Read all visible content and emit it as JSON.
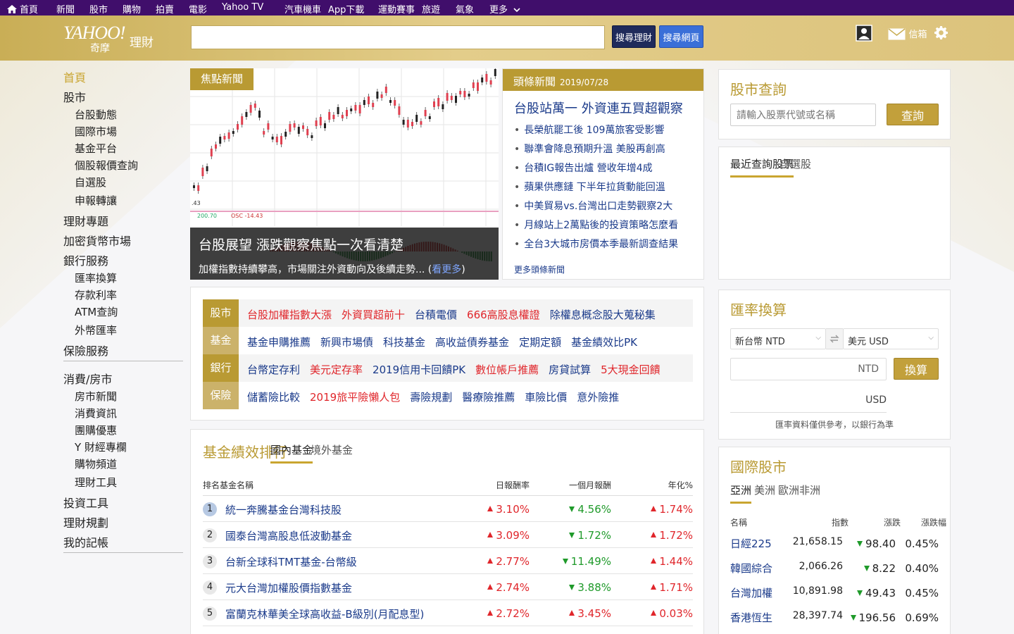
{
  "topnav": {
    "items": [
      "首頁",
      "新聞",
      "股市",
      "購物",
      "拍賣",
      "電影",
      "Yahoo TV",
      "汽車機車",
      "App下載",
      "運動賽事",
      "旅遊",
      "氣象",
      "更多"
    ]
  },
  "header": {
    "logo_text": "YAHOO!",
    "logo_sub": "理財",
    "logo_sub2": "奇摩",
    "search_value": "",
    "search_placeholder": "",
    "search_finance_label": "搜尋理財",
    "search_web_label": "搜尋網頁",
    "mail_label": "信箱"
  },
  "sidebar": {
    "items": [
      {
        "label": "首頁",
        "level": 0,
        "active": true
      },
      {
        "label": "股市",
        "level": 0
      },
      {
        "label": "台股動態",
        "level": 1
      },
      {
        "label": "國際市場",
        "level": 1
      },
      {
        "label": "基金平台",
        "level": 1
      },
      {
        "label": "個股報價查詢",
        "level": 1
      },
      {
        "label": "自選股",
        "level": 1
      },
      {
        "label": "申報轉讓",
        "level": 1
      },
      {
        "label": "理財專題",
        "level": 0
      },
      {
        "label": "加密貨幣市場",
        "level": 0
      },
      {
        "label": "銀行服務",
        "level": 0
      },
      {
        "label": "匯率換算",
        "level": 1
      },
      {
        "label": "存款利率",
        "level": 1
      },
      {
        "label": "ATM查詢",
        "level": 1
      },
      {
        "label": "外幣匯率",
        "level": 1
      },
      {
        "label": "保險服務",
        "level": 0
      },
      {
        "label": "消費/房市",
        "level": 0
      },
      {
        "label": "房市新聞",
        "level": 1
      },
      {
        "label": "消費資訊",
        "level": 1
      },
      {
        "label": "團購優惠",
        "level": 1
      },
      {
        "label": "Y 財經專欄",
        "level": 1
      },
      {
        "label": "購物頻道",
        "level": 1
      },
      {
        "label": "理財工具",
        "level": 1
      },
      {
        "label": "投資工具",
        "level": 0
      },
      {
        "label": "理財規劃",
        "level": 0
      },
      {
        "label": "我的記帳",
        "level": 0
      }
    ]
  },
  "feature": {
    "tag": "焦點新聞",
    "title": "台股展望 漲跌觀察焦點一次看清楚",
    "subtitle": "加權指數持續攀高，市場關注外資動向及後續走勢",
    "more_label": "看更多",
    "chart_labels": {
      "left_axis": ".43",
      "mid": "200.70",
      "osc": "OSC -14.43"
    }
  },
  "topnews": {
    "tag": "頭條新聞",
    "date": "2019/07/28",
    "headline": "台股站萬一 外資連五買超觀察",
    "items": [
      "長榮航罷工後 109萬旅客受影響",
      "聯準會降息預期升溫 美股再創高",
      "台積IG報告出爐 營收年增4成",
      "蘋果供應鏈 下半年拉貨動能回溫",
      "中美貿易vs.台灣出口走勢觀察2大",
      "月線站上2萬點後的投資策略怎麼看",
      "全台3大城市房價本季最新調查結果"
    ],
    "more_label": "更多頭條新聞"
  },
  "tags": {
    "rows": [
      {
        "label": "股市",
        "links": [
          {
            "t": "台股加權指數大漲",
            "red": true
          },
          {
            "t": "外資買超前十",
            "red": true
          },
          {
            "t": "台積電價",
            "red": false
          },
          {
            "t": "666高股息權證",
            "red": true
          },
          {
            "t": "除權息概念股大蒐秘集",
            "red": false
          }
        ]
      },
      {
        "label": "基金",
        "links": [
          {
            "t": "基金申購推薦",
            "red": false
          },
          {
            "t": "新興市場債",
            "red": false
          },
          {
            "t": "科技基金",
            "red": false
          },
          {
            "t": "高收益債券基金",
            "red": false
          },
          {
            "t": "定期定額",
            "red": false
          },
          {
            "t": "基金績效比PK",
            "red": false
          }
        ]
      },
      {
        "label": "銀行",
        "links": [
          {
            "t": "台幣定存利",
            "red": false
          },
          {
            "t": "美元定存率",
            "red": true
          },
          {
            "t": "2019信用卡回饋PK",
            "red": false
          },
          {
            "t": "數位帳戶推薦",
            "red": true
          },
          {
            "t": "房貸試算",
            "red": false
          },
          {
            "t": "5大現金回饋",
            "red": true
          }
        ]
      },
      {
        "label": "保險",
        "links": [
          {
            "t": "儲蓄險比較",
            "red": false
          },
          {
            "t": "2019旅平險懶人包",
            "red": true
          },
          {
            "t": "壽險規劃",
            "red": false
          },
          {
            "t": "醫療險推薦",
            "red": false
          },
          {
            "t": "車險比價",
            "red": false
          },
          {
            "t": "意外險推",
            "red": false
          }
        ]
      }
    ]
  },
  "funds": {
    "title": "基金績效排行",
    "tabs": [
      "國內基金",
      "境外基金"
    ],
    "headers": {
      "rank": "排名",
      "name": "基金名稱",
      "d1": "日報酬率",
      "m1": "一個月報酬",
      "y": "年化%"
    },
    "rows": [
      {
        "rank": "1",
        "name": "統一奔騰基金台灣科技股",
        "d1": "3.10%",
        "d1_up": true,
        "m1": "4.56%",
        "m1_up": false,
        "y": "1.74%",
        "y_up": true
      },
      {
        "rank": "2",
        "name": "國泰台灣高股息低波動基金",
        "d1": "3.09%",
        "d1_up": true,
        "m1": "1.72%",
        "m1_up": false,
        "y": "1.72%",
        "y_up": true
      },
      {
        "rank": "3",
        "name": "台新全球科TMT基金-台幣級",
        "d1": "2.77%",
        "d1_up": true,
        "m1": "11.49%",
        "m1_up": false,
        "y": "1.44%",
        "y_up": true
      },
      {
        "rank": "4",
        "name": "元大台灣加權股價指數基金",
        "d1": "2.74%",
        "d1_up": true,
        "m1": "3.88%",
        "m1_up": false,
        "y": "1.71%",
        "y_up": true
      },
      {
        "rank": "5",
        "name": "富蘭克林華美全球高收益-B級別(月配息型)",
        "d1": "2.72%",
        "d1_up": true,
        "m1": "3.45%",
        "m1_up": true,
        "y": "0.03%",
        "y_up": true
      }
    ]
  },
  "quote": {
    "title": "股市查詢",
    "input_placeholder": "請輸入股票代號或名稱",
    "button": "查詢",
    "tabs": [
      "最近查詢股票",
      "自選股"
    ]
  },
  "fx": {
    "title": "匯率換算",
    "from": "新台幣 NTD",
    "to": "美元 USD",
    "amount_suffix": "NTD",
    "button": "換算",
    "result_suffix": "USD",
    "note": "匯率資料僅供參考，以銀行為準"
  },
  "indices": {
    "title": "國際股市",
    "tabs": [
      "亞洲",
      "美洲",
      "歐洲非洲"
    ],
    "headers": {
      "name": "名稱",
      "price": "指數",
      "chg": "漲跌",
      "pct": "漲跌幅"
    },
    "rows": [
      {
        "name": "日經225",
        "price": "21,658.15",
        "chg": "98.40",
        "pct": "0.45%"
      },
      {
        "name": "韓國綜合",
        "price": "2,066.26",
        "chg": "8.22",
        "pct": "0.40%"
      },
      {
        "name": "台灣加權",
        "price": "10,891.98",
        "chg": "49.43",
        "pct": "0.45%"
      },
      {
        "name": "香港恆生",
        "price": "28,397.74",
        "chg": "196.56",
        "pct": "0.69%"
      }
    ]
  },
  "colors": {
    "brand_purple": "#400e6b",
    "gold": "#b99a33",
    "up": "#e0262b",
    "down": "#1f9a2a",
    "link": "#1a3a8a"
  }
}
